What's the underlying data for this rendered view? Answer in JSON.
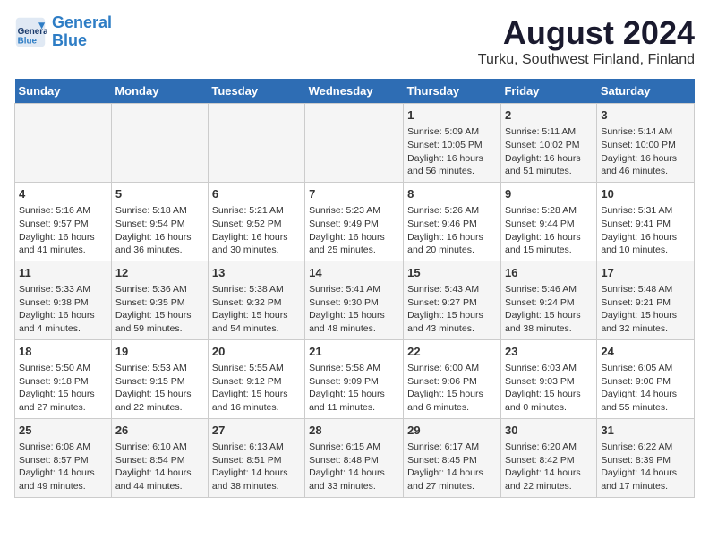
{
  "header": {
    "logo_line1": "General",
    "logo_line2": "Blue",
    "main_title": "August 2024",
    "subtitle": "Turku, Southwest Finland, Finland"
  },
  "weekdays": [
    "Sunday",
    "Monday",
    "Tuesday",
    "Wednesday",
    "Thursday",
    "Friday",
    "Saturday"
  ],
  "weeks": [
    [
      {
        "day": "",
        "content": ""
      },
      {
        "day": "",
        "content": ""
      },
      {
        "day": "",
        "content": ""
      },
      {
        "day": "",
        "content": ""
      },
      {
        "day": "1",
        "content": "Sunrise: 5:09 AM\nSunset: 10:05 PM\nDaylight: 16 hours\nand 56 minutes."
      },
      {
        "day": "2",
        "content": "Sunrise: 5:11 AM\nSunset: 10:02 PM\nDaylight: 16 hours\nand 51 minutes."
      },
      {
        "day": "3",
        "content": "Sunrise: 5:14 AM\nSunset: 10:00 PM\nDaylight: 16 hours\nand 46 minutes."
      }
    ],
    [
      {
        "day": "4",
        "content": "Sunrise: 5:16 AM\nSunset: 9:57 PM\nDaylight: 16 hours\nand 41 minutes."
      },
      {
        "day": "5",
        "content": "Sunrise: 5:18 AM\nSunset: 9:54 PM\nDaylight: 16 hours\nand 36 minutes."
      },
      {
        "day": "6",
        "content": "Sunrise: 5:21 AM\nSunset: 9:52 PM\nDaylight: 16 hours\nand 30 minutes."
      },
      {
        "day": "7",
        "content": "Sunrise: 5:23 AM\nSunset: 9:49 PM\nDaylight: 16 hours\nand 25 minutes."
      },
      {
        "day": "8",
        "content": "Sunrise: 5:26 AM\nSunset: 9:46 PM\nDaylight: 16 hours\nand 20 minutes."
      },
      {
        "day": "9",
        "content": "Sunrise: 5:28 AM\nSunset: 9:44 PM\nDaylight: 16 hours\nand 15 minutes."
      },
      {
        "day": "10",
        "content": "Sunrise: 5:31 AM\nSunset: 9:41 PM\nDaylight: 16 hours\nand 10 minutes."
      }
    ],
    [
      {
        "day": "11",
        "content": "Sunrise: 5:33 AM\nSunset: 9:38 PM\nDaylight: 16 hours\nand 4 minutes."
      },
      {
        "day": "12",
        "content": "Sunrise: 5:36 AM\nSunset: 9:35 PM\nDaylight: 15 hours\nand 59 minutes."
      },
      {
        "day": "13",
        "content": "Sunrise: 5:38 AM\nSunset: 9:32 PM\nDaylight: 15 hours\nand 54 minutes."
      },
      {
        "day": "14",
        "content": "Sunrise: 5:41 AM\nSunset: 9:30 PM\nDaylight: 15 hours\nand 48 minutes."
      },
      {
        "day": "15",
        "content": "Sunrise: 5:43 AM\nSunset: 9:27 PM\nDaylight: 15 hours\nand 43 minutes."
      },
      {
        "day": "16",
        "content": "Sunrise: 5:46 AM\nSunset: 9:24 PM\nDaylight: 15 hours\nand 38 minutes."
      },
      {
        "day": "17",
        "content": "Sunrise: 5:48 AM\nSunset: 9:21 PM\nDaylight: 15 hours\nand 32 minutes."
      }
    ],
    [
      {
        "day": "18",
        "content": "Sunrise: 5:50 AM\nSunset: 9:18 PM\nDaylight: 15 hours\nand 27 minutes."
      },
      {
        "day": "19",
        "content": "Sunrise: 5:53 AM\nSunset: 9:15 PM\nDaylight: 15 hours\nand 22 minutes."
      },
      {
        "day": "20",
        "content": "Sunrise: 5:55 AM\nSunset: 9:12 PM\nDaylight: 15 hours\nand 16 minutes."
      },
      {
        "day": "21",
        "content": "Sunrise: 5:58 AM\nSunset: 9:09 PM\nDaylight: 15 hours\nand 11 minutes."
      },
      {
        "day": "22",
        "content": "Sunrise: 6:00 AM\nSunset: 9:06 PM\nDaylight: 15 hours\nand 6 minutes."
      },
      {
        "day": "23",
        "content": "Sunrise: 6:03 AM\nSunset: 9:03 PM\nDaylight: 15 hours\nand 0 minutes."
      },
      {
        "day": "24",
        "content": "Sunrise: 6:05 AM\nSunset: 9:00 PM\nDaylight: 14 hours\nand 55 minutes."
      }
    ],
    [
      {
        "day": "25",
        "content": "Sunrise: 6:08 AM\nSunset: 8:57 PM\nDaylight: 14 hours\nand 49 minutes."
      },
      {
        "day": "26",
        "content": "Sunrise: 6:10 AM\nSunset: 8:54 PM\nDaylight: 14 hours\nand 44 minutes."
      },
      {
        "day": "27",
        "content": "Sunrise: 6:13 AM\nSunset: 8:51 PM\nDaylight: 14 hours\nand 38 minutes."
      },
      {
        "day": "28",
        "content": "Sunrise: 6:15 AM\nSunset: 8:48 PM\nDaylight: 14 hours\nand 33 minutes."
      },
      {
        "day": "29",
        "content": "Sunrise: 6:17 AM\nSunset: 8:45 PM\nDaylight: 14 hours\nand 27 minutes."
      },
      {
        "day": "30",
        "content": "Sunrise: 6:20 AM\nSunset: 8:42 PM\nDaylight: 14 hours\nand 22 minutes."
      },
      {
        "day": "31",
        "content": "Sunrise: 6:22 AM\nSunset: 8:39 PM\nDaylight: 14 hours\nand 17 minutes."
      }
    ]
  ]
}
